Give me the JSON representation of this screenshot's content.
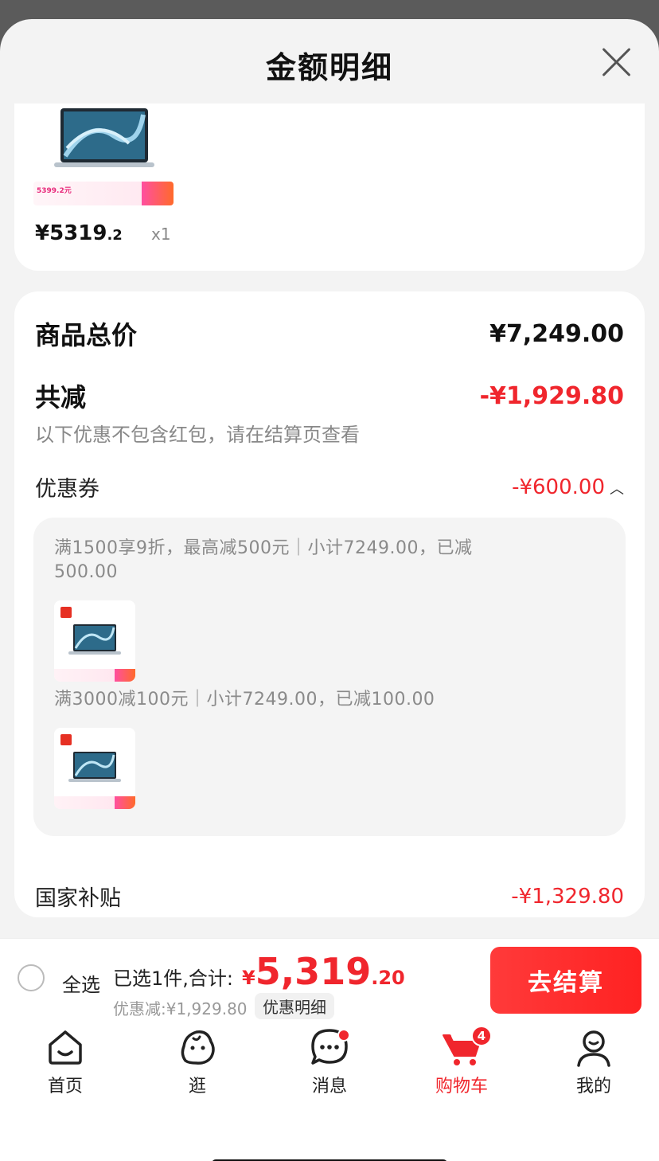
{
  "sheet": {
    "title": "金额明细"
  },
  "product": {
    "price_symbol": "¥",
    "price_int": "5319",
    "price_dec": ".2",
    "qty": "x1",
    "banner_price": "5399.2元"
  },
  "summary": {
    "total_label": "商品总价",
    "total_value": "¥7,249.00",
    "reduce_label": "共减",
    "reduce_value": "-¥1,929.80",
    "reduce_note": "以下优惠不包含红包，请在结算页查看",
    "coupon_label": "优惠券",
    "coupon_value": "-¥600.00",
    "coupon_1": "满1500享9折，最高减500元｜小计7249.00，已减500.00",
    "coupon_2": "满3000减100元｜小计7249.00，已减100.00",
    "subsidy_label": "国家补贴",
    "subsidy_value": "-¥1,329.80"
  },
  "bottom": {
    "select_all": "全选",
    "selected_total": "已选1件,合计:",
    "currency": "¥",
    "amount_int": "5,319",
    "amount_dec": ".20",
    "discount_line": "优惠减:¥1,929.80",
    "detail_chip": "优惠明细",
    "checkout": "去结算"
  },
  "tabs": [
    {
      "label": "首页",
      "icon": "home-icon"
    },
    {
      "label": "逛",
      "icon": "stroll-icon"
    },
    {
      "label": "消息",
      "icon": "message-icon"
    },
    {
      "label": "购物车",
      "icon": "cart-icon",
      "badge": "4"
    },
    {
      "label": "我的",
      "icon": "profile-icon"
    }
  ],
  "colors": {
    "accent_red": "#f0262d",
    "checkout_red": "#ff2a2a"
  }
}
